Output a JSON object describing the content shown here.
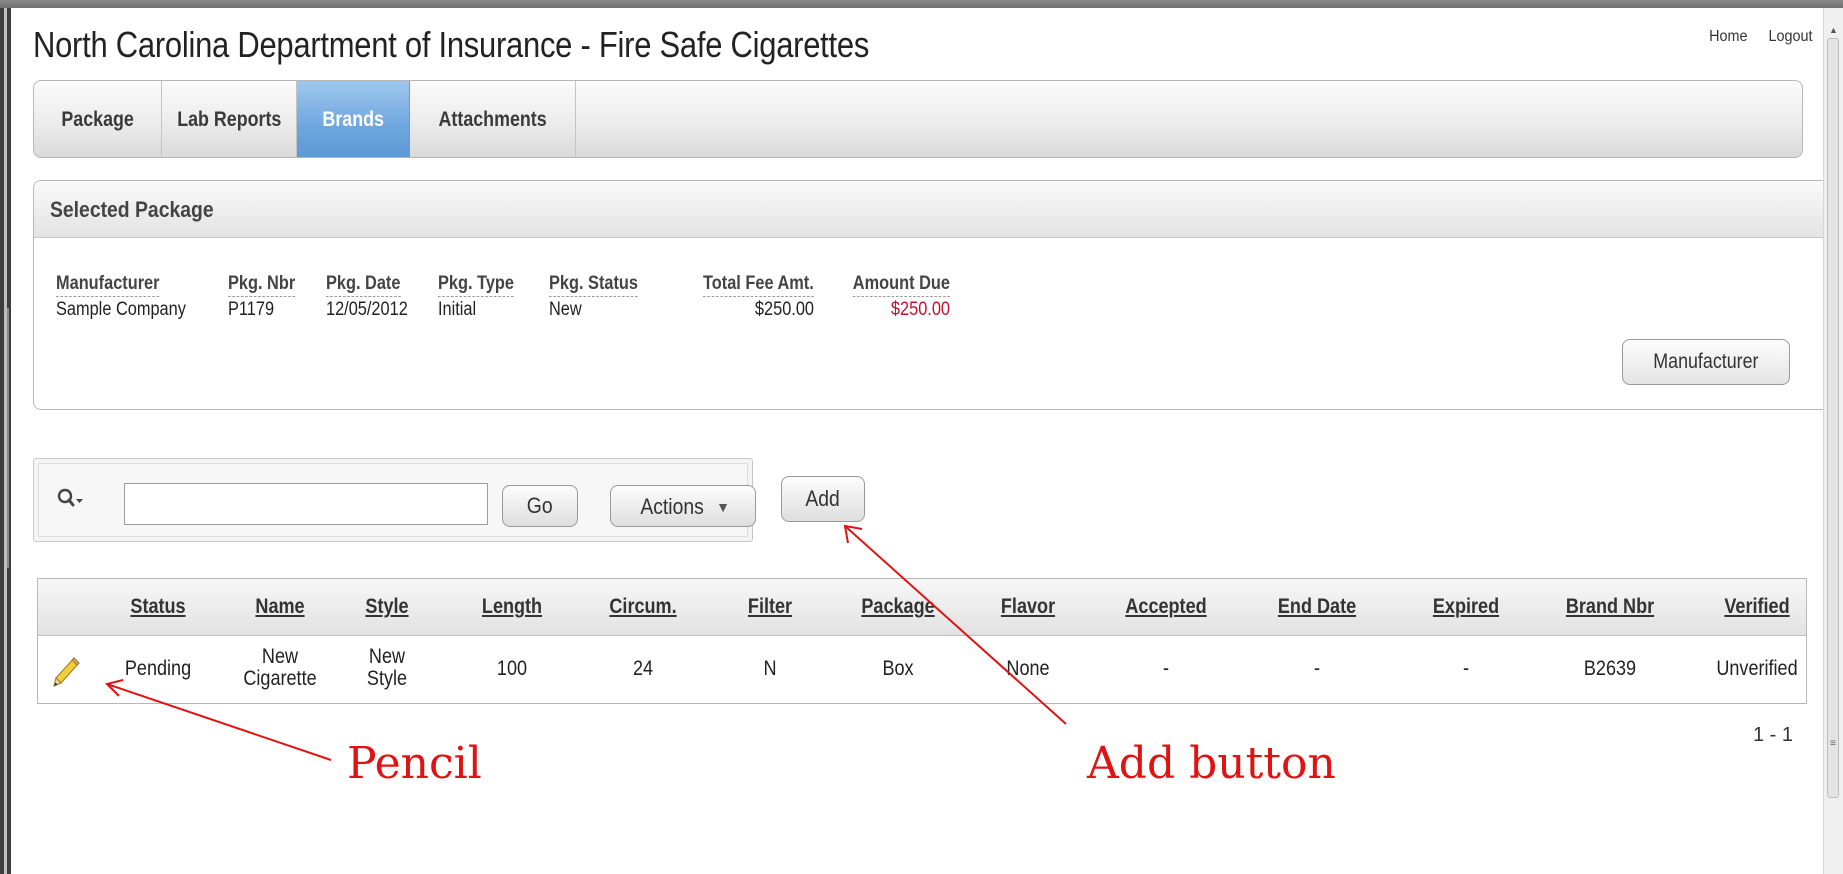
{
  "app": {
    "title": "North Carolina Department of Insurance - Fire Safe Cigarettes",
    "links": [
      "Home",
      "Logout"
    ]
  },
  "tabs": [
    {
      "label": "Package",
      "active": false
    },
    {
      "label": "Lab Reports",
      "active": false
    },
    {
      "label": "Brands",
      "active": true
    },
    {
      "label": "Attachments",
      "active": false
    }
  ],
  "selected_package": {
    "title": "Selected Package",
    "fields": {
      "manufacturer": {
        "label": "Manufacturer",
        "value": "Sample Company"
      },
      "pkg_nbr": {
        "label": "Pkg. Nbr",
        "value": "P1179"
      },
      "pkg_date": {
        "label": "Pkg. Date",
        "value": "12/05/2012"
      },
      "pkg_type": {
        "label": "Pkg. Type",
        "value": "Initial"
      },
      "pkg_status": {
        "label": "Pkg. Status",
        "value": "New"
      },
      "total_fee": {
        "label": "Total Fee Amt.",
        "value": "$250.00"
      },
      "amount_due": {
        "label": "Amount Due",
        "value": "$250.00"
      }
    },
    "manufacturer_button": "Manufacturer"
  },
  "search": {
    "value": "",
    "placeholder": "",
    "go_label": "Go",
    "actions_label": "Actions",
    "add_label": "Add"
  },
  "report": {
    "columns": [
      "Status",
      "Name",
      "Style",
      "Length",
      "Circum.",
      "Filter",
      "Package",
      "Flavor",
      "Accepted",
      "End Date",
      "Expired",
      "Brand Nbr",
      "Verified"
    ],
    "rows": [
      {
        "status": "Pending",
        "name_line1": "New",
        "name_line2": "Cigarette",
        "style_line1": "New",
        "style_line2": "Style",
        "length": "100",
        "circum": "24",
        "filter": "N",
        "package": "Box",
        "flavor": "None",
        "accepted": "-",
        "end_date": "-",
        "expired": "-",
        "brand_nbr": "B2639",
        "verified": "Unverified"
      }
    ],
    "pagination": "1 - 1"
  },
  "annotations": {
    "pencil": "Pencil",
    "add_button": "Add button"
  },
  "colors": {
    "active_tab": "#6da6de",
    "amount_due": "#c8102e",
    "annotation": "#e01212"
  }
}
